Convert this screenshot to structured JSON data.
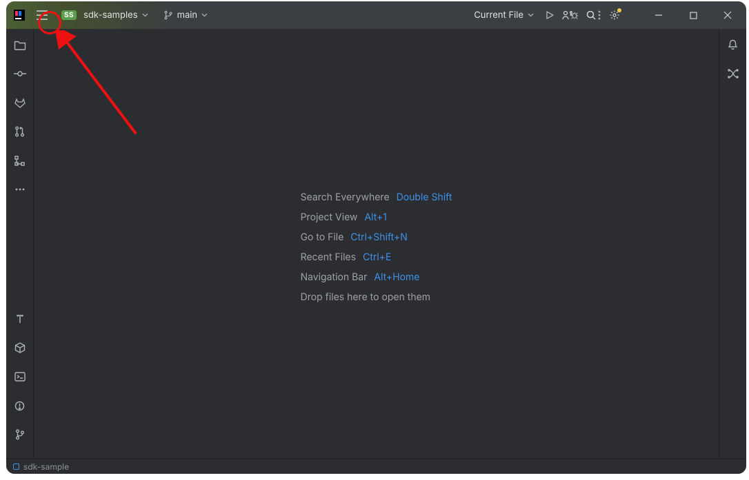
{
  "header": {
    "project_badge": "SS",
    "project_name": "sdk-samples",
    "branch_name": "main",
    "run_config": "Current File"
  },
  "empty_state": {
    "items": [
      {
        "label": "Search Everywhere",
        "shortcut": "Double Shift"
      },
      {
        "label": "Project View",
        "shortcut": "Alt+1"
      },
      {
        "label": "Go to File",
        "shortcut": "Ctrl+Shift+N"
      },
      {
        "label": "Recent Files",
        "shortcut": "Ctrl+E"
      },
      {
        "label": "Navigation Bar",
        "shortcut": "Alt+Home"
      }
    ],
    "drop_hint": "Drop files here to open them"
  },
  "status": {
    "module": "sdk-sample"
  },
  "left_tools": [
    "project",
    "commit",
    "gitlab",
    "pull-requests",
    "structure",
    "more"
  ],
  "left_tools_bottom": [
    "text-tool",
    "build",
    "terminal",
    "problems",
    "git"
  ],
  "right_tools": [
    "notifications",
    "ai-assistant"
  ]
}
